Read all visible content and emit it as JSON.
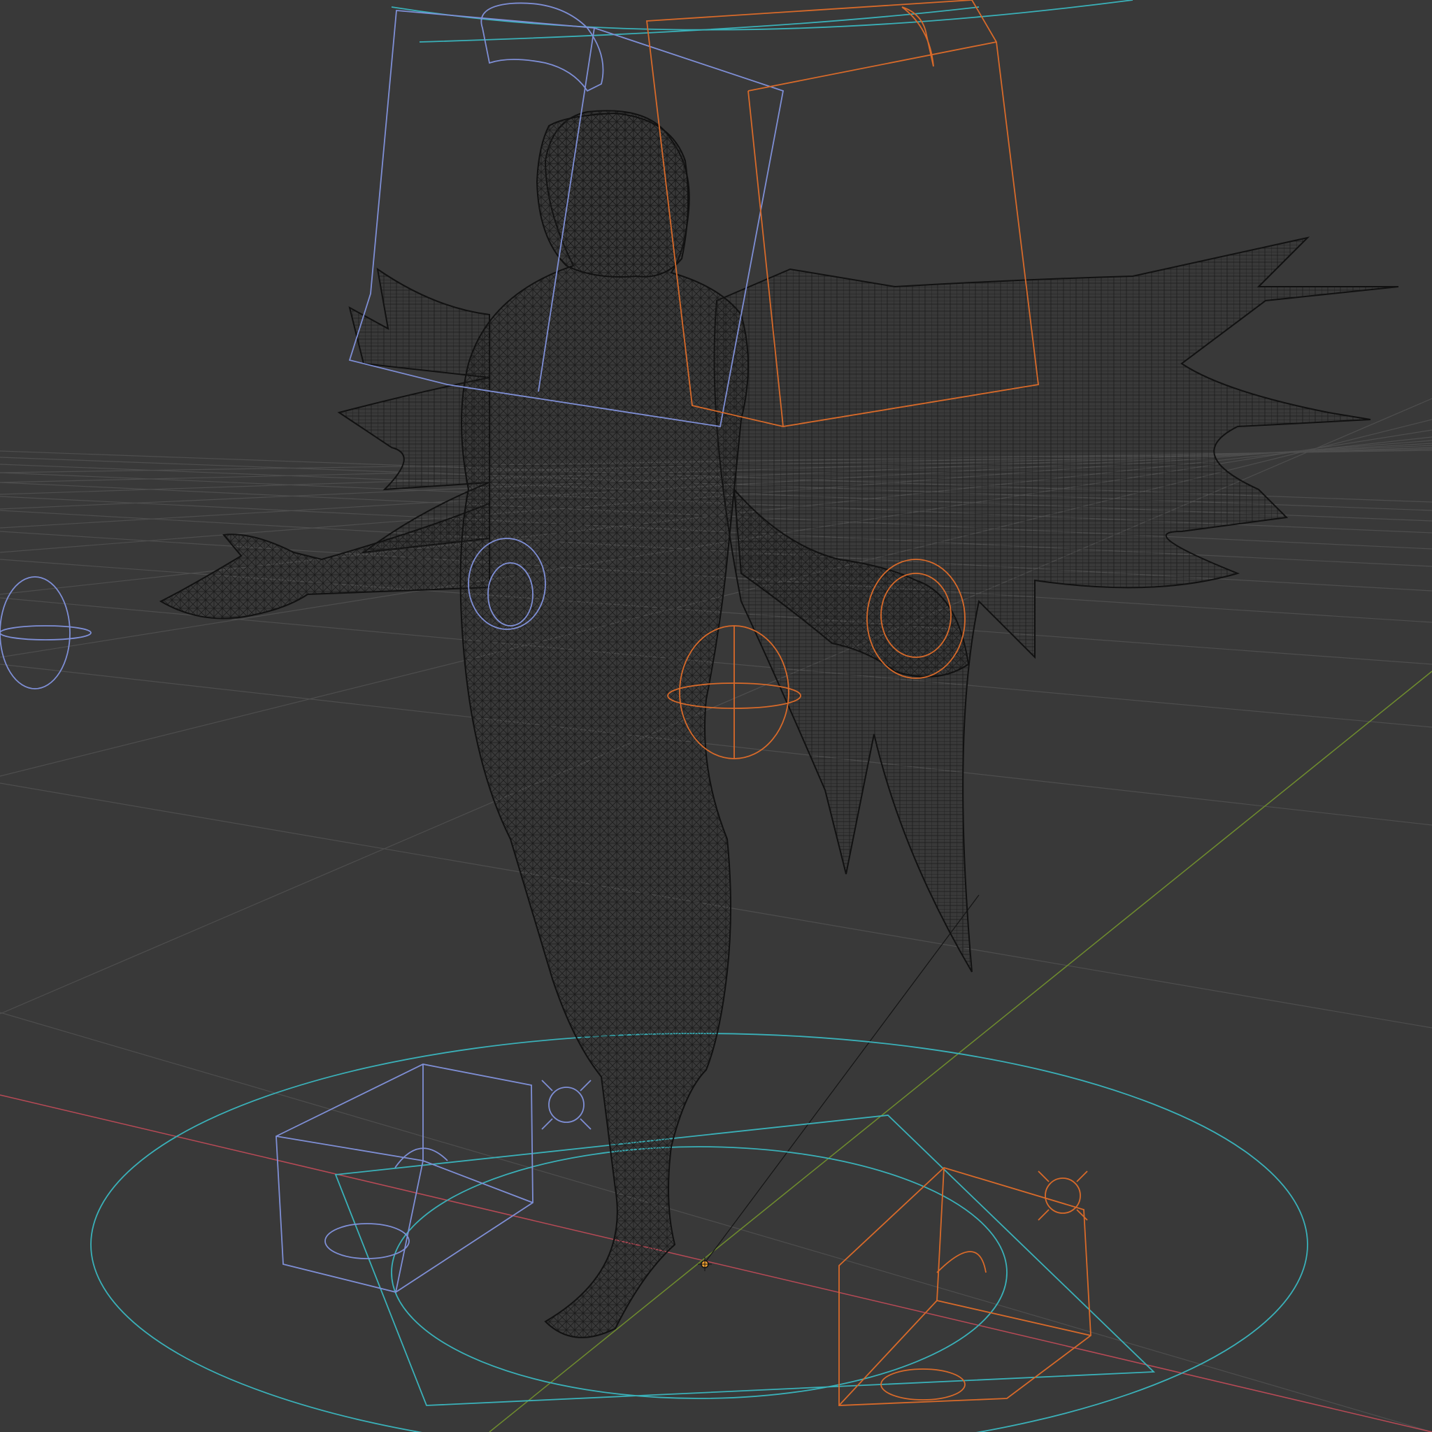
{
  "app": {
    "view": "3D Viewport",
    "shading": "wireframe"
  },
  "colors": {
    "background": "#393939",
    "grid": "#505050",
    "x_axis": "#b84a56",
    "y_axis": "#6f8d2e",
    "mesh_wire": "#111111",
    "rig_blue": "#7f8fd6",
    "rig_orange": "#d86a2a",
    "rig_cyan": "#3ab1b9",
    "origin": "#f0a030"
  },
  "icons": {
    "cursor": "3d-cursor-icon",
    "origin": "world-origin-icon"
  },
  "labels": {}
}
